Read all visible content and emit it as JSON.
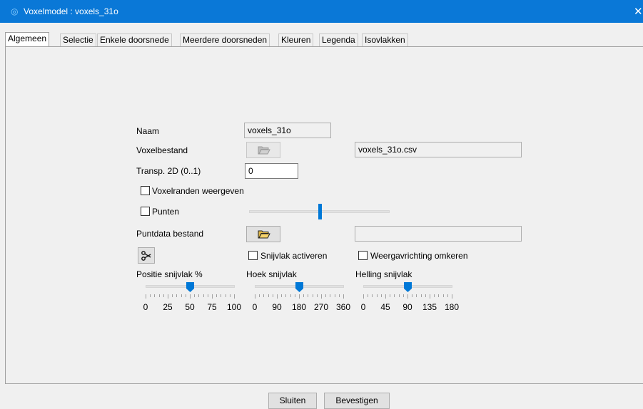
{
  "window": {
    "title": "Voxelmodel : voxels_31o",
    "close_glyph": "✕"
  },
  "tabs": [
    {
      "label": "Algemeen",
      "active": true
    },
    {
      "label": "Selectie"
    },
    {
      "label": "Enkele doorsnede"
    },
    {
      "label": "Meerdere doorsneden"
    },
    {
      "label": "Kleuren"
    },
    {
      "label": "Legenda"
    },
    {
      "label": "Isovlakken"
    }
  ],
  "form": {
    "naam_label": "Naam",
    "naam_value": "voxels_31o",
    "voxelbestand_label": "Voxelbestand",
    "voxelbestand_value": "voxels_31o.csv",
    "transp_label": "Transp. 2D (0..1)",
    "transp_value": "0",
    "voxelranden_label": "Voxelranden weergeven",
    "voxelranden_checked": false,
    "punten_label": "Punten",
    "punten_checked": false,
    "punten_slider_fraction": 0.5,
    "puntdata_label": "Puntdata bestand",
    "puntdata_value": "",
    "snijvlak_label": "Snijvlak activeren",
    "snijvlak_checked": false,
    "weergave_label": "Weergavrichting omkeren",
    "weergave_checked": false
  },
  "sliders": {
    "positie": {
      "label": "Positie snijvlak %",
      "value": 50,
      "min": 0,
      "max": 100,
      "tick_labels": [
        "0",
        "25",
        "50",
        "75",
        "100"
      ]
    },
    "hoek": {
      "label": "Hoek snijvlak",
      "value": 180,
      "min": 0,
      "max": 360,
      "tick_labels": [
        "0",
        "90",
        "180",
        "270",
        "360"
      ]
    },
    "helling": {
      "label": "Helling snijvlak",
      "value": 90,
      "min": 0,
      "max": 180,
      "tick_labels": [
        "0",
        "45",
        "90",
        "135",
        "180"
      ]
    }
  },
  "buttons": {
    "close_label": "Sluiten",
    "confirm_label": "Bevestigen"
  },
  "colors": {
    "titlebar": "#0a78d7",
    "accent": "#0078d7"
  },
  "icons": {
    "voxelbestand_button": "folder-open-icon",
    "puntdata_button": "folder-open-icon",
    "snijvlak_tool": "scissors-icon",
    "window": "eye-icon"
  }
}
